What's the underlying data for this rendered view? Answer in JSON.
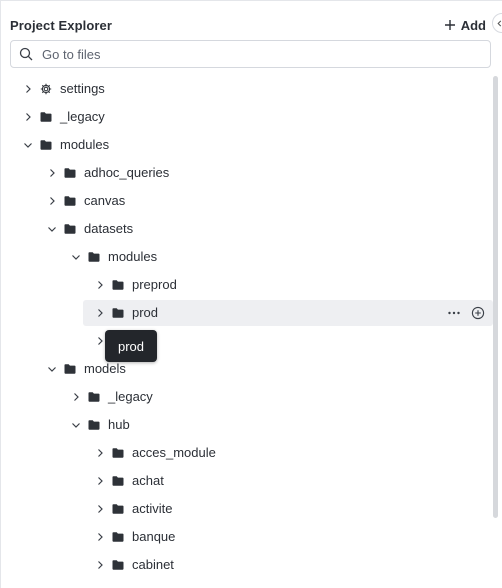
{
  "header": {
    "title": "Project Explorer",
    "add_label": "Add"
  },
  "search": {
    "placeholder": "Go to files",
    "value": ""
  },
  "tree": [
    {
      "label": "settings",
      "depth": 0,
      "expanded": false,
      "icon": "gear-icon"
    },
    {
      "label": "_legacy",
      "depth": 0,
      "expanded": false,
      "icon": "folder-icon"
    },
    {
      "label": "modules",
      "depth": 0,
      "expanded": true,
      "icon": "folder-icon"
    },
    {
      "label": "adhoc_queries",
      "depth": 1,
      "expanded": false,
      "icon": "folder-icon"
    },
    {
      "label": "canvas",
      "depth": 1,
      "expanded": false,
      "icon": "folder-icon"
    },
    {
      "label": "datasets",
      "depth": 1,
      "expanded": true,
      "icon": "folder-icon"
    },
    {
      "label": "modules",
      "depth": 2,
      "expanded": true,
      "icon": "folder-icon"
    },
    {
      "label": "preprod",
      "depth": 3,
      "expanded": false,
      "icon": "folder-icon"
    },
    {
      "label": "prod",
      "depth": 3,
      "expanded": false,
      "icon": "folder-icon",
      "hovered": true
    },
    {
      "label": "",
      "depth": 3,
      "expanded": false,
      "icon": "folder-icon"
    },
    {
      "label": "models",
      "depth": 1,
      "expanded": true,
      "icon": "folder-icon"
    },
    {
      "label": "_legacy",
      "depth": 2,
      "expanded": false,
      "icon": "folder-icon"
    },
    {
      "label": "hub",
      "depth": 2,
      "expanded": true,
      "icon": "folder-icon"
    },
    {
      "label": "acces_module",
      "depth": 3,
      "expanded": false,
      "icon": "folder-icon"
    },
    {
      "label": "achat",
      "depth": 3,
      "expanded": false,
      "icon": "folder-icon"
    },
    {
      "label": "activite",
      "depth": 3,
      "expanded": false,
      "icon": "folder-icon"
    },
    {
      "label": "banque",
      "depth": 3,
      "expanded": false,
      "icon": "folder-icon"
    },
    {
      "label": "cabinet",
      "depth": 3,
      "expanded": false,
      "icon": "folder-icon"
    }
  ],
  "row_actions": {
    "more_icon": "more-horizontal-icon",
    "add_icon": "plus-circle-icon"
  },
  "tooltip": {
    "text": "prod"
  },
  "colors": {
    "text": "#2b2f36",
    "hover_bg": "#eeeff2",
    "tooltip_bg": "#23262b",
    "border": "#d5d8de"
  }
}
